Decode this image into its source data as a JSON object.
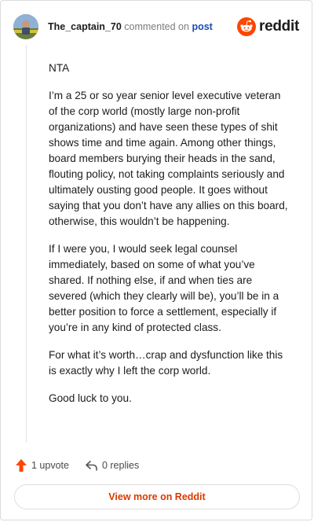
{
  "header": {
    "username": "The_captain_70",
    "commented_on": "commented on",
    "post_link": "post",
    "brand": "reddit"
  },
  "comment": {
    "paragraphs": [
      "NTA",
      "I’m a 25 or so year senior level executive veteran of the corp world (mostly large non-profit organizations) and have seen these types of shit shows time and time again. Among other things, board members burying their heads in the sand, flouting policy, not taking complaints seriously and ultimately ousting good people. It goes without saying that you don’t have any allies on this board, otherwise, this wouldn’t be happening.",
      "If I were you, I would seek legal counsel immediately, based on some of what you’ve shared. If nothing else, if and when ties are severed (which they clearly will be), you’ll be in a better position to force a settlement, especially if you’re in any kind of protected class.",
      "For what it’s worth…crap and dysfunction like this is exactly why I left the corp world.",
      "Good luck to you."
    ]
  },
  "actions": {
    "upvotes": "1 upvote",
    "replies": "0 replies"
  },
  "footer": {
    "view_more": "View more on Reddit"
  },
  "colors": {
    "brand_orange": "#ff4500",
    "link_blue": "#1a4bb5",
    "view_more_text": "#d93a00"
  },
  "icons": [
    "user-avatar",
    "reddit-logo-icon",
    "upvote-arrow-icon",
    "reply-icon"
  ]
}
